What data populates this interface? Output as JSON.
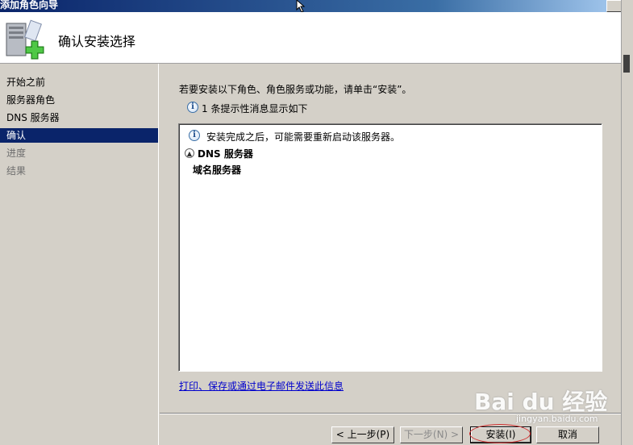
{
  "window": {
    "title": "添加角色向导"
  },
  "header": {
    "title": "确认安装选择"
  },
  "sidebar": {
    "items": [
      {
        "label": "开始之前",
        "state": "normal"
      },
      {
        "label": "服务器角色",
        "state": "normal"
      },
      {
        "label": "DNS 服务器",
        "state": "normal"
      },
      {
        "label": "确认",
        "state": "selected"
      },
      {
        "label": "进度",
        "state": "dim"
      },
      {
        "label": "结果",
        "state": "dim"
      }
    ]
  },
  "main": {
    "instruction": "若要安装以下角色、角色服务或功能，请单击“安装”。",
    "info_message": "1 条提示性消息显示如下",
    "listbox": {
      "notice": "安装完成之后，可能需要重新启动该服务器。",
      "section_title": "DNS 服务器",
      "section_item": "域名服务器"
    },
    "link": "打印、保存或通过电子邮件发送此信息"
  },
  "buttons": {
    "prev": "< 上一步(P)",
    "next": "下一步(N) >",
    "install": "安装(I)",
    "cancel": "取消"
  },
  "watermark": {
    "brand": "Bai du 经验",
    "url": "jingyan.baidu.com"
  },
  "colors": {
    "selection": "#0a246a",
    "link": "#0000cc",
    "highlight_ellipse": "#d03030"
  }
}
